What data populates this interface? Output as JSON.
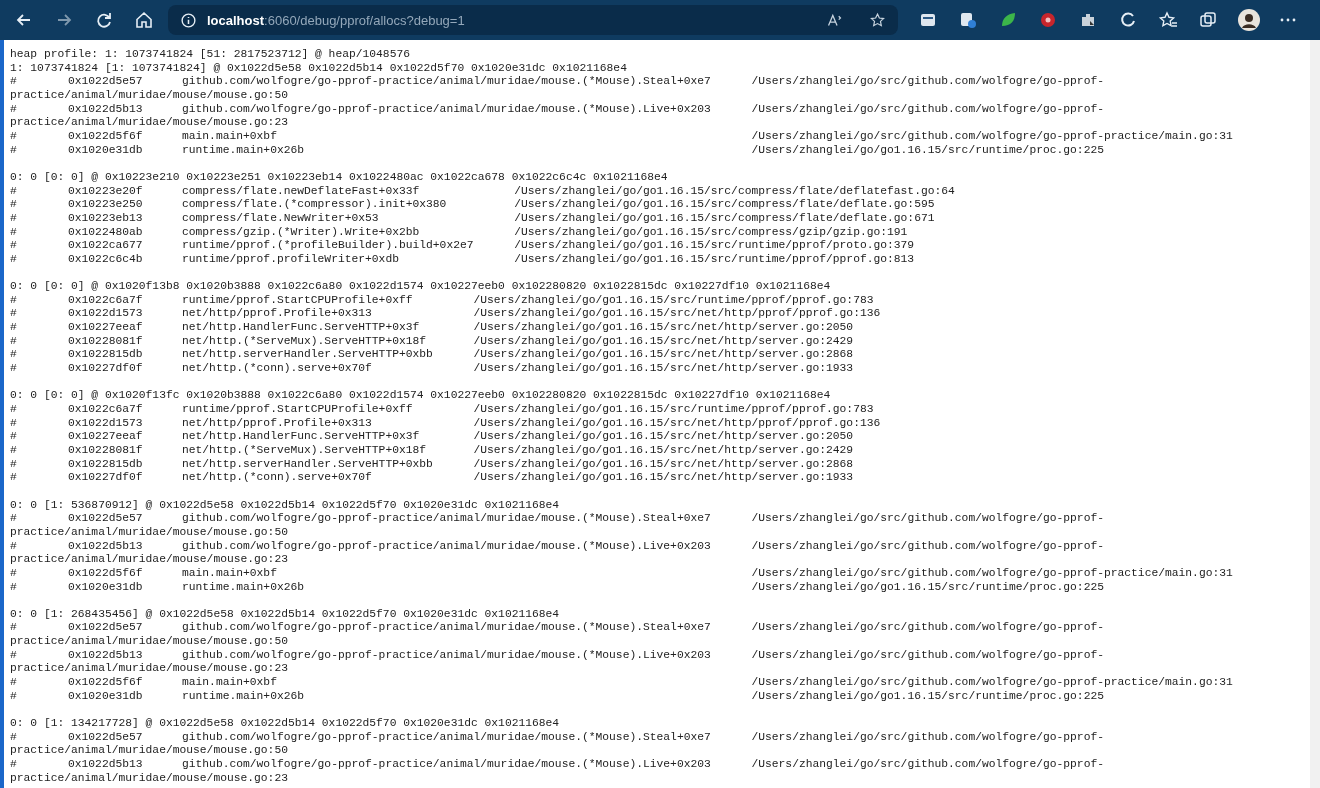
{
  "address_bar": {
    "host": "localhost",
    "rest": ":6060/debug/pprof/allocs?debug=1"
  },
  "profile": {
    "summary": "heap profile: 1: 1073741824 [51: 2817523712] @ heap/1048576",
    "records": [
      {
        "header": "1: 1073741824 [1: 1073741824] @ 0x1022d5e58 0x1022d5b14 0x1022d5f70 0x1020e31dc 0x1021168e4",
        "frames": [
          {
            "marker": "#",
            "address": "0x1022d5e57",
            "function": "github.com/wolfogre/go-pprof-practice/animal/muridae/mouse.(*Mouse).Steal+0xe7",
            "location": "/Users/zhanglei/go/src/github.com/wolfogre/go-pprof-",
            "location_wrap": "practice/animal/muridae/mouse/mouse.go:50"
          },
          {
            "marker": "#",
            "address": "0x1022d5b13",
            "function": "github.com/wolfogre/go-pprof-practice/animal/muridae/mouse.(*Mouse).Live+0x203",
            "location": "/Users/zhanglei/go/src/github.com/wolfogre/go-pprof-",
            "location_wrap": "practice/animal/muridae/mouse/mouse.go:23"
          },
          {
            "marker": "#",
            "address": "0x1022d5f6f",
            "function": "main.main+0xbf",
            "location": "/Users/zhanglei/go/src/github.com/wolfogre/go-pprof-practice/main.go:31"
          },
          {
            "marker": "#",
            "address": "0x1020e31db",
            "function": "runtime.main+0x26b",
            "location": "/Users/zhanglei/go/go1.16.15/src/runtime/proc.go:225"
          }
        ]
      },
      {
        "header": "0: 0 [0: 0] @ 0x10223e210 0x10223e251 0x10223eb14 0x1022480ac 0x1022ca678 0x1022c6c4c 0x1021168e4",
        "frames": [
          {
            "marker": "#",
            "address": "0x10223e20f",
            "function": "compress/flate.newDeflateFast+0x33f",
            "location": "/Users/zhanglei/go/go1.16.15/src/compress/flate/deflatefast.go:64"
          },
          {
            "marker": "#",
            "address": "0x10223e250",
            "function": "compress/flate.(*compressor).init+0x380",
            "location": "/Users/zhanglei/go/go1.16.15/src/compress/flate/deflate.go:595"
          },
          {
            "marker": "#",
            "address": "0x10223eb13",
            "function": "compress/flate.NewWriter+0x53",
            "location": "/Users/zhanglei/go/go1.16.15/src/compress/flate/deflate.go:671"
          },
          {
            "marker": "#",
            "address": "0x1022480ab",
            "function": "compress/gzip.(*Writer).Write+0x2bb",
            "location": "/Users/zhanglei/go/go1.16.15/src/compress/gzip/gzip.go:191"
          },
          {
            "marker": "#",
            "address": "0x1022ca677",
            "function": "runtime/pprof.(*profileBuilder).build+0x2e7",
            "location": "/Users/zhanglei/go/go1.16.15/src/runtime/pprof/proto.go:379"
          },
          {
            "marker": "#",
            "address": "0x1022c6c4b",
            "function": "runtime/pprof.profileWriter+0xdb",
            "location": "/Users/zhanglei/go/go1.16.15/src/runtime/pprof/pprof.go:813"
          }
        ]
      },
      {
        "header": "0: 0 [0: 0] @ 0x1020f13b8 0x1020b3888 0x1022c6a80 0x1022d1574 0x10227eeb0 0x102280820 0x1022815dc 0x10227df10 0x1021168e4",
        "frames": [
          {
            "marker": "#",
            "address": "0x1022c6a7f",
            "function": "runtime/pprof.StartCPUProfile+0xff",
            "location": "/Users/zhanglei/go/go1.16.15/src/runtime/pprof/pprof.go:783"
          },
          {
            "marker": "#",
            "address": "0x1022d1573",
            "function": "net/http/pprof.Profile+0x313",
            "location": "/Users/zhanglei/go/go1.16.15/src/net/http/pprof/pprof.go:136"
          },
          {
            "marker": "#",
            "address": "0x10227eeaf",
            "function": "net/http.HandlerFunc.ServeHTTP+0x3f",
            "location": "/Users/zhanglei/go/go1.16.15/src/net/http/server.go:2050"
          },
          {
            "marker": "#",
            "address": "0x10228081f",
            "function": "net/http.(*ServeMux).ServeHTTP+0x18f",
            "location": "/Users/zhanglei/go/go1.16.15/src/net/http/server.go:2429"
          },
          {
            "marker": "#",
            "address": "0x1022815db",
            "function": "net/http.serverHandler.ServeHTTP+0xbb",
            "location": "/Users/zhanglei/go/go1.16.15/src/net/http/server.go:2868"
          },
          {
            "marker": "#",
            "address": "0x10227df0f",
            "function": "net/http.(*conn).serve+0x70f",
            "location": "/Users/zhanglei/go/go1.16.15/src/net/http/server.go:1933"
          }
        ]
      },
      {
        "header": "0: 0 [0: 0] @ 0x1020f13fc 0x1020b3888 0x1022c6a80 0x1022d1574 0x10227eeb0 0x102280820 0x1022815dc 0x10227df10 0x1021168e4",
        "frames": [
          {
            "marker": "#",
            "address": "0x1022c6a7f",
            "function": "runtime/pprof.StartCPUProfile+0xff",
            "location": "/Users/zhanglei/go/go1.16.15/src/runtime/pprof/pprof.go:783"
          },
          {
            "marker": "#",
            "address": "0x1022d1573",
            "function": "net/http/pprof.Profile+0x313",
            "location": "/Users/zhanglei/go/go1.16.15/src/net/http/pprof/pprof.go:136"
          },
          {
            "marker": "#",
            "address": "0x10227eeaf",
            "function": "net/http.HandlerFunc.ServeHTTP+0x3f",
            "location": "/Users/zhanglei/go/go1.16.15/src/net/http/server.go:2050"
          },
          {
            "marker": "#",
            "address": "0x10228081f",
            "function": "net/http.(*ServeMux).ServeHTTP+0x18f",
            "location": "/Users/zhanglei/go/go1.16.15/src/net/http/server.go:2429"
          },
          {
            "marker": "#",
            "address": "0x1022815db",
            "function": "net/http.serverHandler.ServeHTTP+0xbb",
            "location": "/Users/zhanglei/go/go1.16.15/src/net/http/server.go:2868"
          },
          {
            "marker": "#",
            "address": "0x10227df0f",
            "function": "net/http.(*conn).serve+0x70f",
            "location": "/Users/zhanglei/go/go1.16.15/src/net/http/server.go:1933"
          }
        ]
      },
      {
        "header": "0: 0 [1: 536870912] @ 0x1022d5e58 0x1022d5b14 0x1022d5f70 0x1020e31dc 0x1021168e4",
        "frames": [
          {
            "marker": "#",
            "address": "0x1022d5e57",
            "function": "github.com/wolfogre/go-pprof-practice/animal/muridae/mouse.(*Mouse).Steal+0xe7",
            "location": "/Users/zhanglei/go/src/github.com/wolfogre/go-pprof-",
            "location_wrap": "practice/animal/muridae/mouse/mouse.go:50"
          },
          {
            "marker": "#",
            "address": "0x1022d5b13",
            "function": "github.com/wolfogre/go-pprof-practice/animal/muridae/mouse.(*Mouse).Live+0x203",
            "location": "/Users/zhanglei/go/src/github.com/wolfogre/go-pprof-",
            "location_wrap": "practice/animal/muridae/mouse/mouse.go:23"
          },
          {
            "marker": "#",
            "address": "0x1022d5f6f",
            "function": "main.main+0xbf",
            "location": "/Users/zhanglei/go/src/github.com/wolfogre/go-pprof-practice/main.go:31"
          },
          {
            "marker": "#",
            "address": "0x1020e31db",
            "function": "runtime.main+0x26b",
            "location": "/Users/zhanglei/go/go1.16.15/src/runtime/proc.go:225"
          }
        ]
      },
      {
        "header": "0: 0 [1: 268435456] @ 0x1022d5e58 0x1022d5b14 0x1022d5f70 0x1020e31dc 0x1021168e4",
        "frames": [
          {
            "marker": "#",
            "address": "0x1022d5e57",
            "function": "github.com/wolfogre/go-pprof-practice/animal/muridae/mouse.(*Mouse).Steal+0xe7",
            "location": "/Users/zhanglei/go/src/github.com/wolfogre/go-pprof-",
            "location_wrap": "practice/animal/muridae/mouse/mouse.go:50"
          },
          {
            "marker": "#",
            "address": "0x1022d5b13",
            "function": "github.com/wolfogre/go-pprof-practice/animal/muridae/mouse.(*Mouse).Live+0x203",
            "location": "/Users/zhanglei/go/src/github.com/wolfogre/go-pprof-",
            "location_wrap": "practice/animal/muridae/mouse/mouse.go:23"
          },
          {
            "marker": "#",
            "address": "0x1022d5f6f",
            "function": "main.main+0xbf",
            "location": "/Users/zhanglei/go/src/github.com/wolfogre/go-pprof-practice/main.go:31"
          },
          {
            "marker": "#",
            "address": "0x1020e31db",
            "function": "runtime.main+0x26b",
            "location": "/Users/zhanglei/go/go1.16.15/src/runtime/proc.go:225"
          }
        ]
      },
      {
        "header": "0: 0 [1: 134217728] @ 0x1022d5e58 0x1022d5b14 0x1022d5f70 0x1020e31dc 0x1021168e4",
        "frames": [
          {
            "marker": "#",
            "address": "0x1022d5e57",
            "function": "github.com/wolfogre/go-pprof-practice/animal/muridae/mouse.(*Mouse).Steal+0xe7",
            "location": "/Users/zhanglei/go/src/github.com/wolfogre/go-pprof-",
            "location_wrap": "practice/animal/muridae/mouse/mouse.go:50"
          },
          {
            "marker": "#",
            "address": "0x1022d5b13",
            "function": "github.com/wolfogre/go-pprof-practice/animal/muridae/mouse.(*Mouse).Live+0x203",
            "location": "/Users/zhanglei/go/src/github.com/wolfogre/go-pprof-",
            "location_wrap": "practice/animal/muridae/mouse/mouse.go:23"
          }
        ]
      }
    ]
  }
}
